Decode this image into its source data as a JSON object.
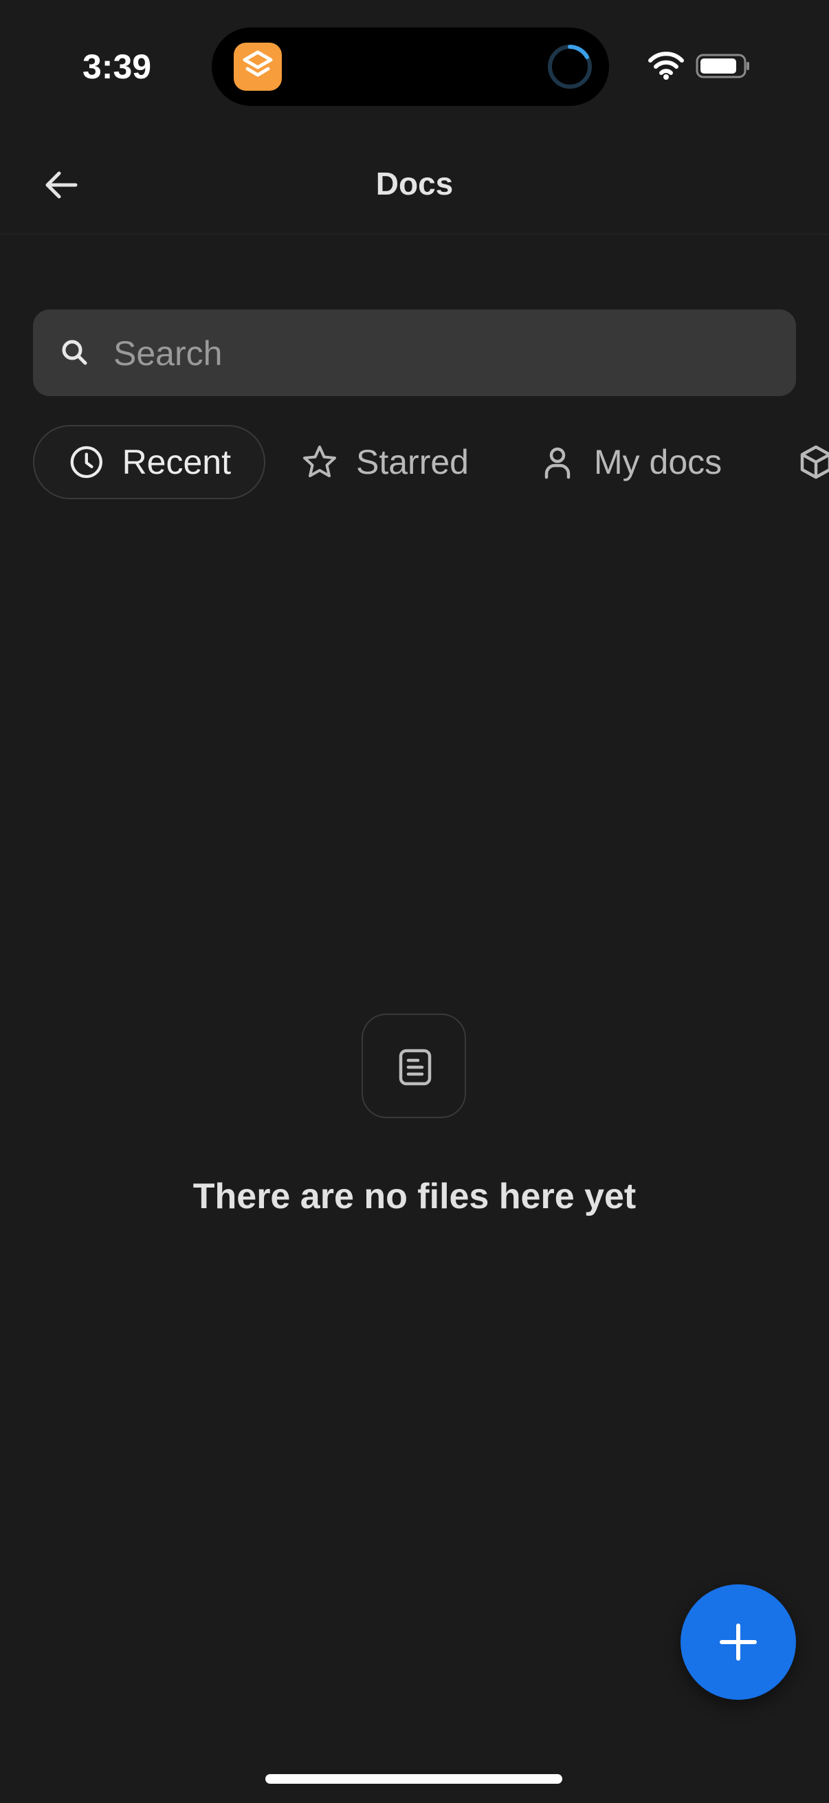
{
  "status_bar": {
    "time": "3:39",
    "colors": {
      "app_icon": "#f79d3c",
      "activity_ring": "#3aa0e8"
    }
  },
  "header": {
    "title": "Docs",
    "back_icon": "arrow-left-icon"
  },
  "search": {
    "placeholder": "Search",
    "value": ""
  },
  "tabs": [
    {
      "label": "Recent",
      "icon": "clock-icon",
      "active": true
    },
    {
      "label": "Starred",
      "icon": "star-icon",
      "active": false
    },
    {
      "label": "My docs",
      "icon": "person-icon",
      "active": false
    },
    {
      "label": "",
      "icon": "box-icon",
      "active": false
    }
  ],
  "empty_state": {
    "icon": "document-icon",
    "message": "There are no files here yet"
  },
  "fab": {
    "icon": "plus-icon",
    "color": "#1872e8"
  },
  "theme": {
    "background": "#1b1b1b",
    "search_background": "#383838"
  }
}
